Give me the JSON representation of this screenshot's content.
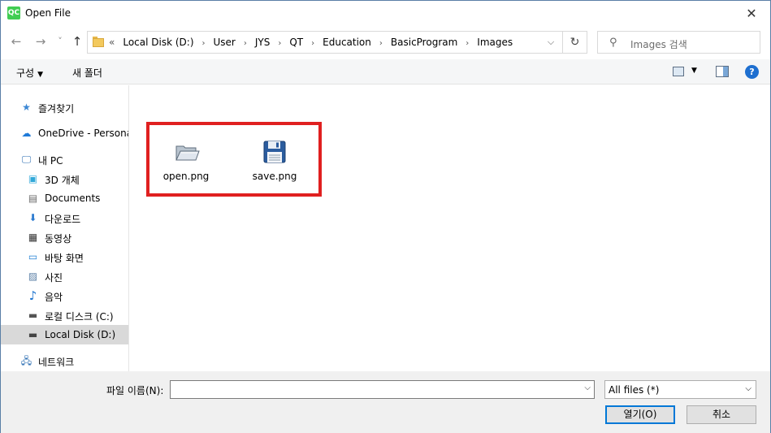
{
  "window": {
    "title": "Open File",
    "app_icon_text": "QC",
    "close_glyph": "✕"
  },
  "nav": {
    "back_glyph": "←",
    "forward_glyph": "→",
    "recent_glyph": "˅",
    "up_glyph": "↑",
    "breadcrumb_prefix": "«",
    "breadcrumbs": [
      "Local Disk (D:)",
      "User",
      "JYS",
      "QT",
      "Education",
      "BasicProgram",
      "Images"
    ],
    "separator": "›",
    "dropdown_glyph": "⌵",
    "refresh_glyph": "↻",
    "search_placeholder": "Images 검색",
    "search_glyph": "⚲"
  },
  "toolbar": {
    "organize_label": "구성",
    "new_folder_label": "새 폴더",
    "help_label": "?"
  },
  "sidebar": {
    "items": [
      {
        "label": "즐겨찾기",
        "icon": "star-icon",
        "glyph": "★"
      },
      {
        "label": "OneDrive - Personal",
        "icon": "cloud-icon",
        "glyph": "☁"
      },
      {
        "label": "내 PC",
        "icon": "computer-icon",
        "glyph": "🖵"
      },
      {
        "label": "3D 개체",
        "icon": "cube-icon",
        "glyph": "▣"
      },
      {
        "label": "Documents",
        "icon": "document-icon",
        "glyph": "▤"
      },
      {
        "label": "다운로드",
        "icon": "download-icon",
        "glyph": "⬇"
      },
      {
        "label": "동영상",
        "icon": "video-icon",
        "glyph": "▦"
      },
      {
        "label": "바탕 화면",
        "icon": "desktop-icon",
        "glyph": "▭"
      },
      {
        "label": "사진",
        "icon": "pictures-icon",
        "glyph": "▨"
      },
      {
        "label": "음악",
        "icon": "music-icon",
        "glyph": "♪"
      },
      {
        "label": "로컬 디스크 (C:)",
        "icon": "drive-c-icon",
        "glyph": "▬"
      },
      {
        "label": "Local Disk (D:)",
        "icon": "drive-d-icon",
        "glyph": "▬"
      },
      {
        "label": "네트워크",
        "icon": "network-icon",
        "glyph": "🖧"
      }
    ],
    "selected_index": 11
  },
  "files": [
    {
      "name": "open.png",
      "icon": "open-folder-icon"
    },
    {
      "name": "save.png",
      "icon": "floppy-save-icon"
    }
  ],
  "bottom": {
    "filename_label": "파일 이름(N):",
    "filename_value": "",
    "filter_value": "All files (*)",
    "open_button": "열기(O)",
    "cancel_button": "취소"
  },
  "colors": {
    "accent": "#0078d7",
    "highlight": "#e02020",
    "selected_bg": "#d9d9d9"
  }
}
